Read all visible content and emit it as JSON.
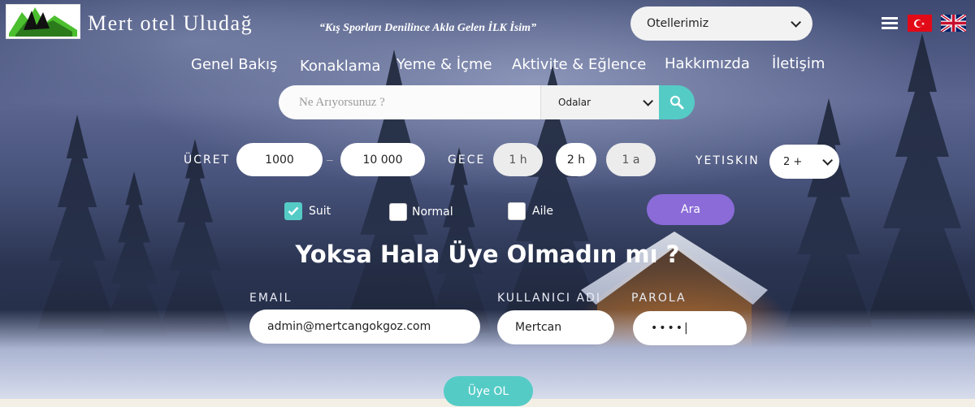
{
  "header": {
    "brand": "Mert otel Uludağ",
    "slogan": "“Kış Sporları Denilince Akla Gelen İLK İsim”",
    "hotels_select": "Otellerimiz"
  },
  "nav": [
    "Genel Bakış",
    "Konaklama",
    "Yeme & İçme",
    "Aktivite & Eğlence",
    "Hakkımızda",
    "İletişim"
  ],
  "search": {
    "placeholder": "Ne Arıyorsunuz ?",
    "category": "Odalar"
  },
  "filters": {
    "price_label": "ÜCRET",
    "price_min": "1000",
    "price_max": "10 000",
    "night_label": "GECE",
    "night_options": [
      "1 h",
      "2 h",
      "1 a"
    ],
    "adult_label": "YETISKIN",
    "adult_value": "2 +",
    "room_types": [
      {
        "label": "Suit",
        "checked": true
      },
      {
        "label": "Normal",
        "checked": false
      },
      {
        "label": "Aile",
        "checked": false
      }
    ],
    "search_button": "Ara"
  },
  "signup": {
    "headline": "Yoksa Hala Üye Olmadın mı ?",
    "email_label": "EMAIL",
    "email_value": "admin@mertcangokgoz.com",
    "username_label": "KULLANICI ADI",
    "username_value": "Mertcan",
    "password_label": "PAROLA",
    "password_value": "••••|",
    "submit": "Üye OL"
  },
  "colors": {
    "accent_teal": "#55cbc6",
    "accent_purple": "#8a6bd8"
  }
}
